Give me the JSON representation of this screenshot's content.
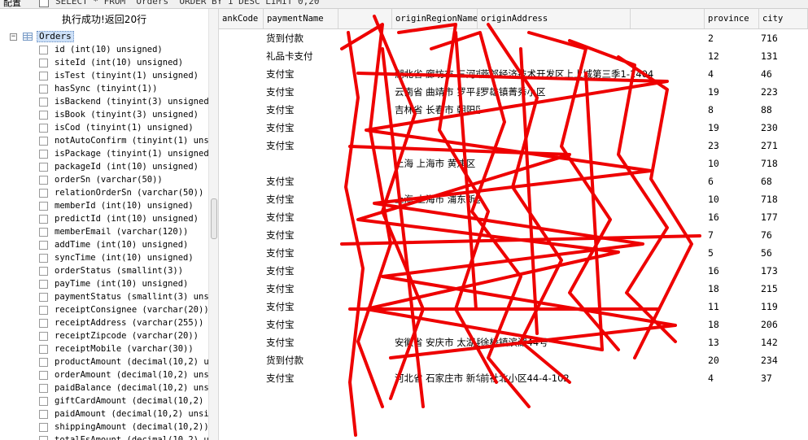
{
  "toolbar": {
    "config_label": "配置",
    "query_text": "SELECT * FROM `Orders` ORDER BY 1 DESC LIMIT 0,20"
  },
  "status_message": "执行成功!返回20行",
  "tree": {
    "table_name": "Orders",
    "fields": [
      "id (int(10) unsigned)",
      "siteId (int(10) unsigned)",
      "isTest (tinyint(1) unsigned)",
      "hasSync (tinyint(1))",
      "isBackend (tinyint(3) unsigned)",
      "isBook (tinyint(3) unsigned)",
      "isCod (tinyint(1) unsigned)",
      "notAutoConfirm (tinyint(1) unsi",
      "isPackage (tinyint(1) unsigned)",
      "packageId (int(10) unsigned)",
      "orderSn (varchar(50))",
      "relationOrderSn (varchar(50))",
      "memberId (int(10) unsigned)",
      "predictId (int(10) unsigned)",
      "memberEmail (varchar(120))",
      "addTime (int(10) unsigned)",
      "syncTime (int(10) unsigned)",
      "orderStatus (smallint(3))",
      "payTime (int(10) unsigned)",
      "paymentStatus (smallint(3) unsi",
      "receiptConsignee (varchar(20))",
      "receiptAddress (varchar(255))",
      "receiptZipcode (varchar(20))",
      "receiptMobile (varchar(30))",
      "productAmount (decimal(10,2) un",
      "orderAmount (decimal(10,2) unsi",
      "paidBalance (decimal(10,2) unsi",
      "giftCardAmount (decimal(10,2) u",
      "paidAmount (decimal(10,2) unsig",
      "shippingAmount (decimal(10,2))",
      "totalEsAmount (decimal(10,2) un"
    ]
  },
  "grid": {
    "columns": [
      "ankCode",
      "paymentName",
      "",
      "originRegionName",
      "originAddress",
      "",
      "province",
      "city"
    ],
    "rows": [
      {
        "payment": "货到付款",
        "region": "",
        "address": "",
        "province": "2",
        "city": "716"
      },
      {
        "payment": "礼品卡支付",
        "region": "",
        "address": "",
        "province": "12",
        "city": "131"
      },
      {
        "payment": "支付宝",
        "region": "湖北省 廊坊市 三河市",
        "address": "燕郊经济技术开发区上上城第三季1-1404",
        "province": "4",
        "city": "46"
      },
      {
        "payment": "支付宝",
        "region": "云南省 曲靖市 罗平县",
        "address": "罗雄镇菁秀小区",
        "province": "19",
        "city": "223"
      },
      {
        "payment": "支付宝",
        "region": "吉林省 长春市 朝阳区",
        "address": "",
        "province": "8",
        "city": "88"
      },
      {
        "payment": "支付宝",
        "region": "",
        "address": "",
        "province": "19",
        "city": "230"
      },
      {
        "payment": "支付宝",
        "region": "",
        "address": "",
        "province": "23",
        "city": "271"
      },
      {
        "payment": "",
        "region": "上海 上海市 黄浦区",
        "address": "",
        "province": "10",
        "city": "718"
      },
      {
        "payment": "支付宝",
        "region": "",
        "address": "",
        "province": "6",
        "city": "68"
      },
      {
        "payment": "支付宝",
        "region": "上海 上海市 浦东新区",
        "address": "",
        "province": "10",
        "city": "718"
      },
      {
        "payment": "支付宝",
        "region": "",
        "address": "",
        "province": "16",
        "city": "177"
      },
      {
        "payment": "支付宝",
        "region": "",
        "address": "",
        "province": "7",
        "city": "76"
      },
      {
        "payment": "支付宝",
        "region": "",
        "address": "",
        "province": "5",
        "city": "56"
      },
      {
        "payment": "支付宝",
        "region": "",
        "address": "",
        "province": "16",
        "city": "173"
      },
      {
        "payment": "支付宝",
        "region": "",
        "address": "",
        "province": "18",
        "city": "215"
      },
      {
        "payment": "支付宝",
        "region": "",
        "address": "",
        "province": "11",
        "city": "119"
      },
      {
        "payment": "支付宝",
        "region": "",
        "address": "",
        "province": "18",
        "city": "206"
      },
      {
        "payment": "支付宝",
        "region": "安徽省 安庆市 太湖县",
        "address": "徐桥镇滨湖44号",
        "province": "13",
        "city": "142"
      },
      {
        "payment": "货到付款",
        "region": "",
        "address": "",
        "province": "20",
        "city": "234"
      },
      {
        "payment": "支付宝",
        "region": "河北省 石家庄市 新华区",
        "address": "前社北小区44-4-102",
        "province": "4",
        "city": "37"
      }
    ]
  },
  "colors": {
    "scribble": "#ee0000",
    "selection": "#cde0f7"
  }
}
